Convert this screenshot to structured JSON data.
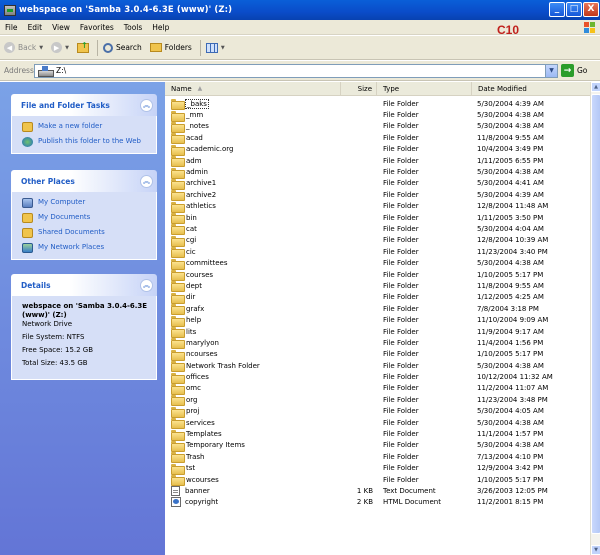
{
  "window": {
    "title": "webspace on 'Samba 3.0.4-6.3E (www)' (Z:)",
    "buttons": [
      "_",
      "□",
      "X"
    ],
    "annotation": "C10"
  },
  "menu": [
    "File",
    "Edit",
    "View",
    "Favorites",
    "Tools",
    "Help"
  ],
  "toolbar": {
    "back_label": "Back",
    "search_label": "Search",
    "folders_label": "Folders"
  },
  "address": {
    "label": "Address",
    "value": "Z:\\",
    "go_label": "Go"
  },
  "tasks_panel": {
    "file_folder_tasks": {
      "title": "File and Folder Tasks",
      "items": [
        "Make a new folder",
        "Publish this folder to the Web"
      ]
    },
    "other_places": {
      "title": "Other Places",
      "items": [
        "My Computer",
        "My Documents",
        "Shared Documents",
        "My Network Places"
      ]
    },
    "details": {
      "title": "Details",
      "name": "webspace on 'Samba 3.0.4-6.3E (www)' (Z:)",
      "kind": "Network Drive",
      "filesystem": "File System: NTFS",
      "free": "Free Space: 15.2 GB",
      "total": "Total Size: 43.5 GB"
    }
  },
  "columns": {
    "name": "Name",
    "size": "Size",
    "type": "Type",
    "date": "Date Modified"
  },
  "files": [
    {
      "name": "_baks",
      "size": "",
      "type": "File Folder",
      "date": "5/30/2004 4:39 AM",
      "kind": "folder"
    },
    {
      "name": "_mm",
      "size": "",
      "type": "File Folder",
      "date": "5/30/2004 4:38 AM",
      "kind": "folder"
    },
    {
      "name": "_notes",
      "size": "",
      "type": "File Folder",
      "date": "5/30/2004 4:38 AM",
      "kind": "folder"
    },
    {
      "name": "acad",
      "size": "",
      "type": "File Folder",
      "date": "11/8/2004 9:55 AM",
      "kind": "folder"
    },
    {
      "name": "academic.org",
      "size": "",
      "type": "File Folder",
      "date": "10/4/2004 3:49 PM",
      "kind": "folder"
    },
    {
      "name": "adm",
      "size": "",
      "type": "File Folder",
      "date": "1/11/2005 6:55 PM",
      "kind": "folder"
    },
    {
      "name": "admin",
      "size": "",
      "type": "File Folder",
      "date": "5/30/2004 4:38 AM",
      "kind": "folder"
    },
    {
      "name": "archive1",
      "size": "",
      "type": "File Folder",
      "date": "5/30/2004 4:41 AM",
      "kind": "folder"
    },
    {
      "name": "archive2",
      "size": "",
      "type": "File Folder",
      "date": "5/30/2004 4:39 AM",
      "kind": "folder"
    },
    {
      "name": "athletics",
      "size": "",
      "type": "File Folder",
      "date": "12/8/2004 11:48 AM",
      "kind": "folder"
    },
    {
      "name": "bin",
      "size": "",
      "type": "File Folder",
      "date": "1/11/2005 3:50 PM",
      "kind": "folder"
    },
    {
      "name": "cat",
      "size": "",
      "type": "File Folder",
      "date": "5/30/2004 4:04 AM",
      "kind": "folder"
    },
    {
      "name": "cgi",
      "size": "",
      "type": "File Folder",
      "date": "12/8/2004 10:39 AM",
      "kind": "folder"
    },
    {
      "name": "cic",
      "size": "",
      "type": "File Folder",
      "date": "11/23/2004 3:40 PM",
      "kind": "folder"
    },
    {
      "name": "committees",
      "size": "",
      "type": "File Folder",
      "date": "5/30/2004 4:38 AM",
      "kind": "folder"
    },
    {
      "name": "courses",
      "size": "",
      "type": "File Folder",
      "date": "1/10/2005 5:17 PM",
      "kind": "folder"
    },
    {
      "name": "dept",
      "size": "",
      "type": "File Folder",
      "date": "11/8/2004 9:55 AM",
      "kind": "folder"
    },
    {
      "name": "dir",
      "size": "",
      "type": "File Folder",
      "date": "1/12/2005 4:25 AM",
      "kind": "folder"
    },
    {
      "name": "grafx",
      "size": "",
      "type": "File Folder",
      "date": "7/8/2004 3:18 PM",
      "kind": "folder"
    },
    {
      "name": "help",
      "size": "",
      "type": "File Folder",
      "date": "11/10/2004 9:09 AM",
      "kind": "folder"
    },
    {
      "name": "lits",
      "size": "",
      "type": "File Folder",
      "date": "11/9/2004 9:17 AM",
      "kind": "folder"
    },
    {
      "name": "marylyon",
      "size": "",
      "type": "File Folder",
      "date": "11/4/2004 1:56 PM",
      "kind": "folder"
    },
    {
      "name": "ncourses",
      "size": "",
      "type": "File Folder",
      "date": "1/10/2005 5:17 PM",
      "kind": "folder"
    },
    {
      "name": "Network Trash Folder",
      "size": "",
      "type": "File Folder",
      "date": "5/30/2004 4:38 AM",
      "kind": "folder"
    },
    {
      "name": "offices",
      "size": "",
      "type": "File Folder",
      "date": "10/12/2004 11:32 AM",
      "kind": "folder"
    },
    {
      "name": "omc",
      "size": "",
      "type": "File Folder",
      "date": "11/2/2004 11:07 AM",
      "kind": "folder"
    },
    {
      "name": "org",
      "size": "",
      "type": "File Folder",
      "date": "11/23/2004 3:48 PM",
      "kind": "folder"
    },
    {
      "name": "proj",
      "size": "",
      "type": "File Folder",
      "date": "5/30/2004 4:05 AM",
      "kind": "folder"
    },
    {
      "name": "services",
      "size": "",
      "type": "File Folder",
      "date": "5/30/2004 4:38 AM",
      "kind": "folder"
    },
    {
      "name": "Templates",
      "size": "",
      "type": "File Folder",
      "date": "11/1/2004 1:57 PM",
      "kind": "folder"
    },
    {
      "name": "Temporary Items",
      "size": "",
      "type": "File Folder",
      "date": "5/30/2004 4:38 AM",
      "kind": "folder"
    },
    {
      "name": "Trash",
      "size": "",
      "type": "File Folder",
      "date": "7/13/2004 4:10 PM",
      "kind": "folder"
    },
    {
      "name": "tst",
      "size": "",
      "type": "File Folder",
      "date": "12/9/2004 3:42 PM",
      "kind": "folder"
    },
    {
      "name": "wcourses",
      "size": "",
      "type": "File Folder",
      "date": "1/10/2005 5:17 PM",
      "kind": "folder"
    },
    {
      "name": "banner",
      "size": "1 KB",
      "type": "Text Document",
      "date": "3/26/2003 12:05 PM",
      "kind": "text"
    },
    {
      "name": "copyright",
      "size": "2 KB",
      "type": "HTML Document",
      "date": "11/2/2001 8:15 PM",
      "kind": "html"
    }
  ],
  "colors": {
    "titlebar": "#0a4cc9",
    "taskpane": "#6d8ede",
    "panel_title": "#215dc6",
    "annotation": "#c0201c"
  }
}
